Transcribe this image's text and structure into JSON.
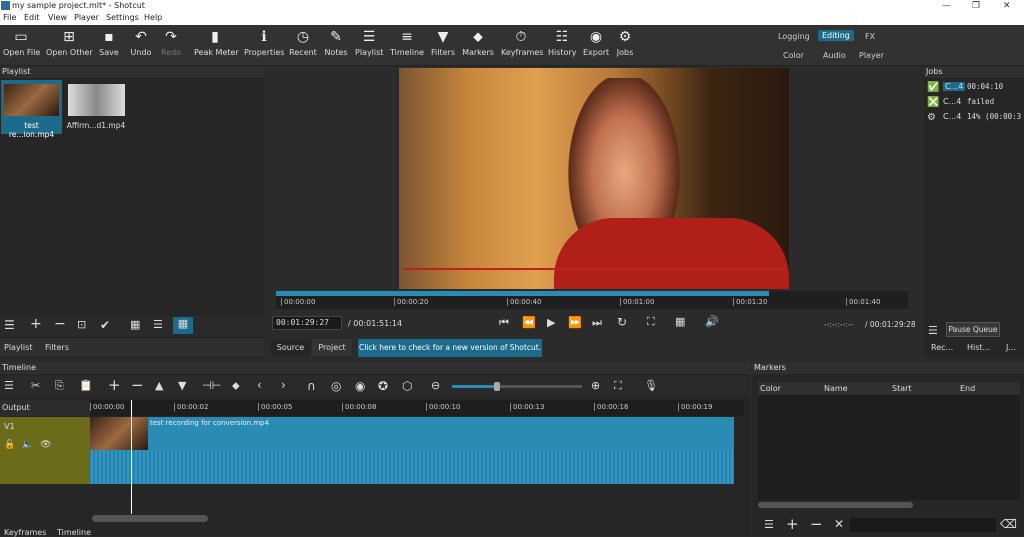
{
  "window": {
    "title": "my sample project.mlt* - Shotcut",
    "minimize": "—",
    "maximize": "❐",
    "close": "✕"
  },
  "menu": [
    "File",
    "Edit",
    "View",
    "Player",
    "Settings",
    "Help"
  ],
  "toolbar": [
    {
      "label": "Open File",
      "icon": "▭"
    },
    {
      "label": "Open Other",
      "icon": "⊞"
    },
    {
      "label": "Save",
      "icon": "▪"
    },
    {
      "label": "Undo",
      "icon": "↶"
    },
    {
      "label": "Redo",
      "icon": "↷"
    },
    {
      "label": "Peak Meter",
      "icon": "▮"
    },
    {
      "label": "Properties",
      "icon": "ℹ"
    },
    {
      "label": "Recent",
      "icon": "◷"
    },
    {
      "label": "Notes",
      "icon": "✎"
    },
    {
      "label": "Playlist",
      "icon": "☰"
    },
    {
      "label": "Timeline",
      "icon": "≡"
    },
    {
      "label": "Filters",
      "icon": "▼"
    },
    {
      "label": "Markers",
      "icon": "⬥"
    },
    {
      "label": "Keyframes",
      "icon": "⏱"
    },
    {
      "label": "History",
      "icon": "☷"
    },
    {
      "label": "Export",
      "icon": "◉"
    },
    {
      "label": "Jobs",
      "icon": "⚙"
    }
  ],
  "layouts": {
    "logging": "Logging",
    "editing": "Editing",
    "fx": "FX",
    "color": "Color",
    "audio": "Audio",
    "player": "Player"
  },
  "playlist": {
    "title": "Playlist",
    "items": [
      "test re...ion.mp4",
      "Affirm...d1.mp4"
    ],
    "tab_playlist": "Playlist",
    "tab_filters": "Filters"
  },
  "player": {
    "timecode": "00:01:29:27",
    "duration": "/ 00:01:51:14",
    "in_point": "--:--:--:--",
    "out_point": "/ 00:01:29:28",
    "ticks": [
      "00:00:00",
      "00:00:20",
      "00:00:40",
      "00:01:00",
      "00:01:20",
      "00:01:40"
    ],
    "progress": 0.78,
    "tab_source": "Source",
    "tab_project": "Project",
    "update_msg": "Click here to check for a new version of Shotcut."
  },
  "jobs": {
    "title": "Jobs",
    "items": [
      {
        "name": "C...4",
        "status": "00:04:10",
        "icon": "check-icon"
      },
      {
        "name": "C...4",
        "status": "failed",
        "icon": "fail-icon"
      },
      {
        "name": "C...4",
        "status": "14% (00:00:3",
        "icon": "gear-icon"
      }
    ],
    "pause": "Pause Queue",
    "tab_recent": "Rec...",
    "tab_history": "Hist...",
    "tab_jobs": "J..."
  },
  "timeline": {
    "title": "Timeline",
    "output": "Output",
    "track": "V1",
    "clip": "test recording for conversion.mp4",
    "ticks": [
      "00:00:00",
      "00:00:02",
      "00:00:05",
      "00:00:08",
      "00:00:10",
      "00:00:13",
      "00:00:16",
      "00:00:19"
    ],
    "tab_keyframes": "Keyframes",
    "tab_timeline": "Timeline"
  },
  "markers": {
    "title": "Markers",
    "cols": [
      "Color",
      "Name",
      "Start",
      "End"
    ]
  },
  "colors": {
    "accent": "#1d6b8a",
    "clip": "#2a8bb5",
    "track": "#6b6b1a"
  }
}
